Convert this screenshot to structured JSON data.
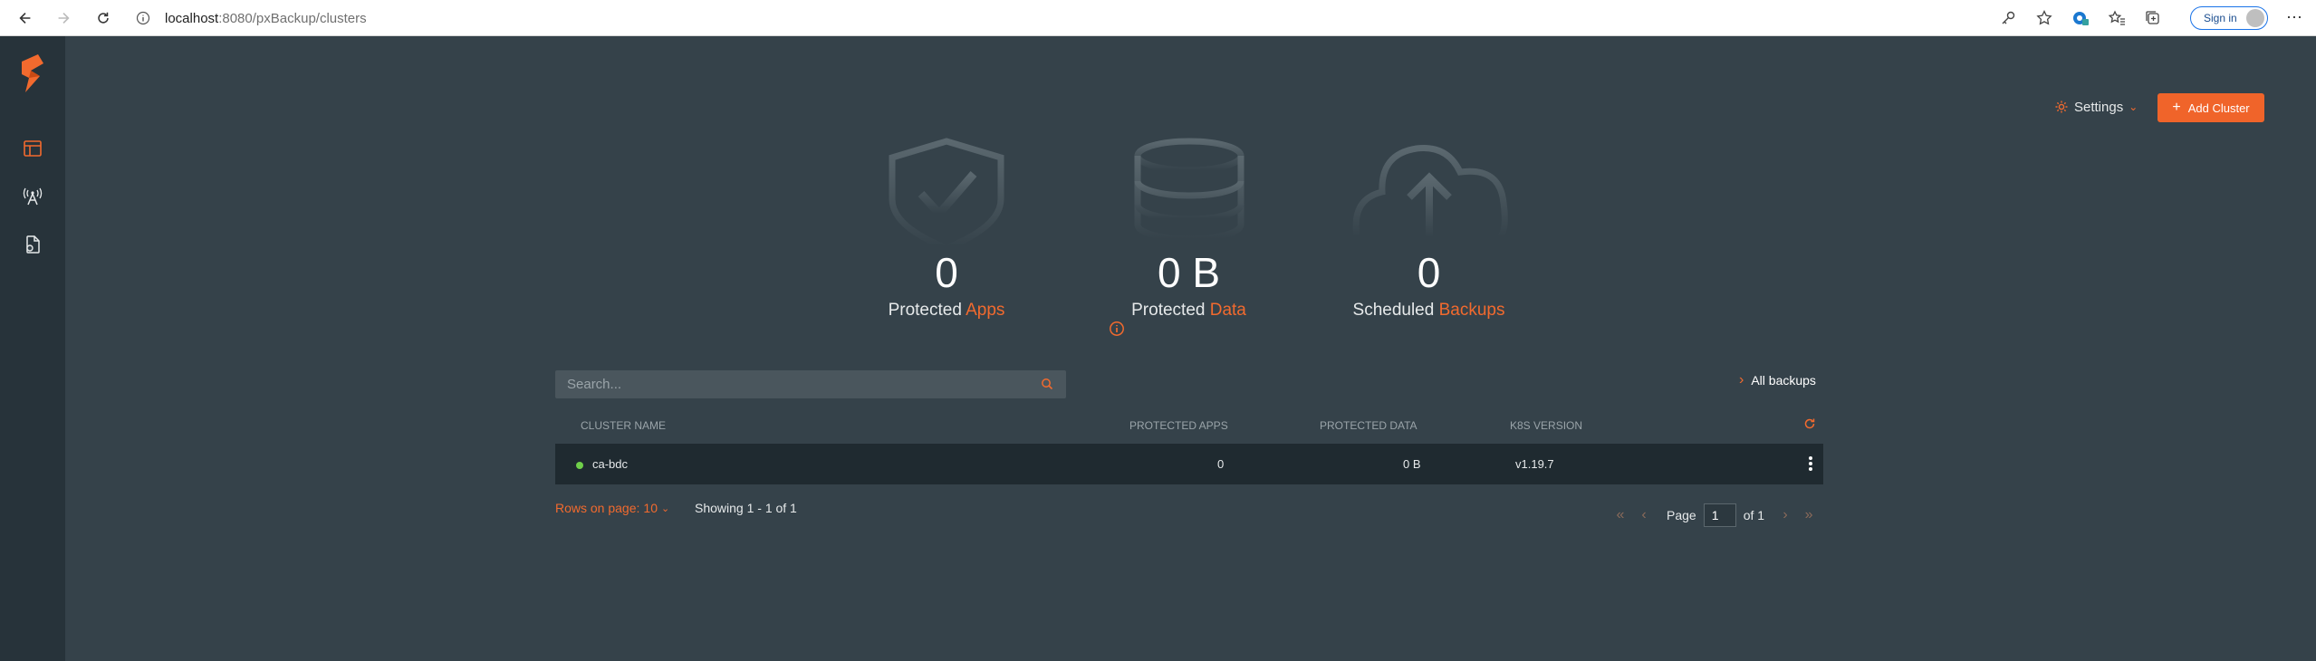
{
  "browser": {
    "url_host": "localhost",
    "url_path": ":8080/pxBackup/clusters",
    "sign_in_label": "Sign in",
    "more_label": "⋯"
  },
  "sidebar": {
    "items": [
      {
        "icon": "clusters-icon"
      },
      {
        "icon": "antenna-icon"
      },
      {
        "icon": "document-icon"
      }
    ]
  },
  "header": {
    "settings_label": "Settings",
    "add_cluster_label": "Add Cluster"
  },
  "stats": {
    "apps": {
      "value": "0",
      "prefix": "Protected",
      "accent": "Apps"
    },
    "data": {
      "value": "0 B",
      "prefix": "Protected",
      "accent": "Data"
    },
    "backups": {
      "value": "0",
      "prefix": "Scheduled",
      "accent": "Backups"
    }
  },
  "search": {
    "placeholder": "Search...",
    "value": ""
  },
  "all_backups_label": "All backups",
  "table": {
    "columns": [
      "CLUSTER NAME",
      "PROTECTED APPS",
      "PROTECTED DATA",
      "K8S VERSION"
    ],
    "rows": [
      {
        "name": "ca-bdc",
        "status": "online",
        "protected_apps": "0",
        "protected_data": "0 B",
        "k8s_version": "v1.19.7"
      }
    ]
  },
  "footer": {
    "rows_on_page_label": "Rows on page:",
    "rows_on_page_value": "10",
    "showing": "Showing 1 - 1 of 1",
    "page_label": "Page",
    "page_value": "1",
    "of_label": "of 1"
  },
  "colors": {
    "accent": "#f26a2e",
    "background": "#35424a",
    "sidebar": "#27333a",
    "row": "#1f2a30",
    "status_online": "#6fcf4a"
  }
}
